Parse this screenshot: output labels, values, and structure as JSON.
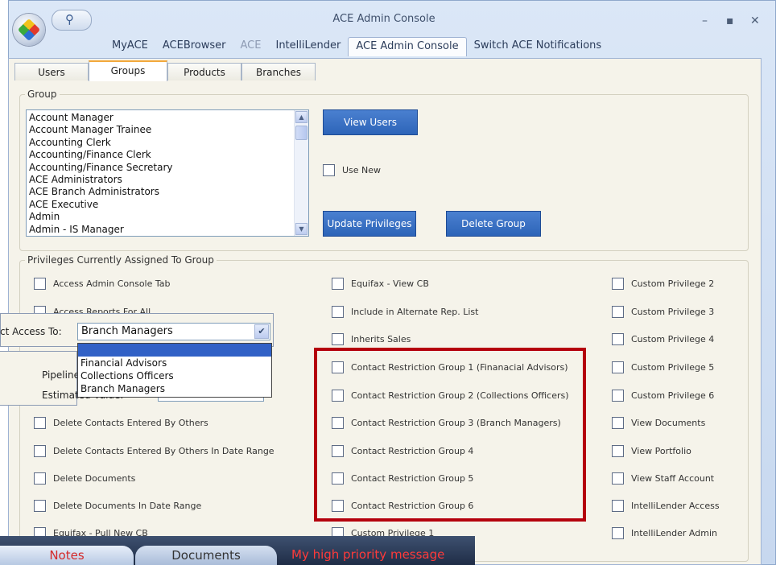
{
  "window": {
    "title": "ACE Admin Console",
    "minimize": "–",
    "maximize": "▪",
    "close": "✕"
  },
  "quick_access": {
    "icon": "search-icon"
  },
  "menu": [
    {
      "label": "MyACE",
      "state": "normal"
    },
    {
      "label": "ACEBrowser",
      "state": "normal"
    },
    {
      "label": "ACE",
      "state": "disabled"
    },
    {
      "label": "IntelliLender",
      "state": "normal"
    },
    {
      "label": "ACE Admin Console",
      "state": "active"
    },
    {
      "label": "Switch ACE Notifications",
      "state": "normal"
    }
  ],
  "tabs": [
    {
      "label": "Users"
    },
    {
      "label": "Groups"
    },
    {
      "label": "Products"
    },
    {
      "label": "Branches"
    }
  ],
  "group": {
    "legend": "Group",
    "items": [
      "Account Manager",
      "Account Manager Trainee",
      "Accounting Clerk",
      "Accounting/Finance Clerk",
      "Accounting/Finance Secretary",
      "ACE Administrators",
      "ACE Branch Administrators",
      "ACE Executive",
      "Admin",
      "Admin - IS Manager"
    ],
    "view_users": "View Users",
    "use_new": "Use New",
    "update_privileges": "Update Privileges",
    "delete_group": "Delete Group"
  },
  "privileges": {
    "legend": "Privileges Currently Assigned To Group",
    "col1": [
      "Access Admin Console Tab",
      "Access Reports For All",
      "Delete Contacts Entered By Others",
      "Delete Contacts Entered By Others In Date Range",
      "Delete Documents",
      "Delete Documents In Date Range",
      "Equifax - Pull New CB"
    ],
    "col2": [
      "Equifax - View CB",
      "Include in Alternate Rep. List",
      "Inherits Sales",
      "Contact Restriction Group 1 (Finanacial Advisors)",
      "Contact Restriction Group 2 (Collections Officers)",
      "Contact Restriction Group 3 (Branch Managers)",
      "Contact Restriction Group 4",
      "Contact Restriction Group 5",
      "Contact Restriction Group 6",
      "Custom Privilege 1"
    ],
    "col3": [
      "Custom Privilege 2",
      "Custom Privilege 3",
      "Custom Privilege 4",
      "Custom Privilege 5",
      "Custom Privilege 6",
      "View Documents",
      "View Portfolio",
      "View Staff Account",
      "IntelliLender Access",
      "IntelliLender Admin"
    ]
  },
  "restrict": {
    "label": "ct Access To:",
    "selected": "Branch Managers",
    "options": [
      "Financial Advisors",
      "Collections Officers",
      "Branch Managers"
    ]
  },
  "pipeline": {
    "label": "Pipeline",
    "estimated": "Estimated Value:"
  },
  "bottom": {
    "notes": "Notes",
    "documents": "Documents",
    "message": "My high priority message"
  }
}
